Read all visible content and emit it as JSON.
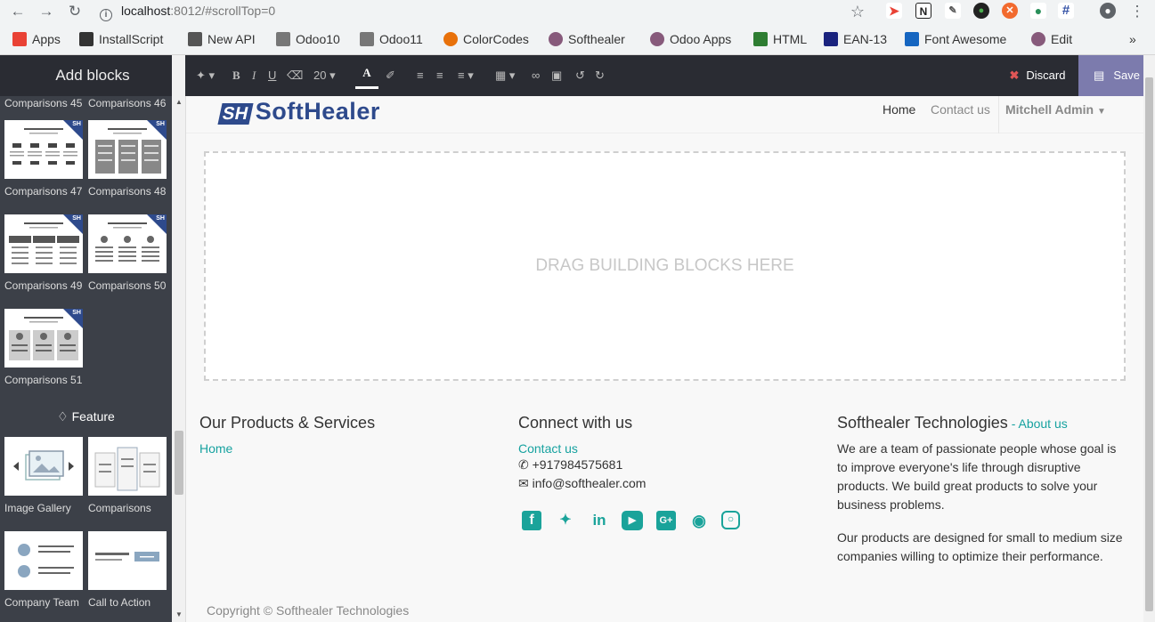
{
  "browser": {
    "url_host": "localhost",
    "url_rest": ":8012/#scrollTop=0",
    "bookmarks": [
      {
        "label": "Apps",
        "icon": "apps-grid-icon",
        "color": "#e94235"
      },
      {
        "label": "InstallScript",
        "icon": "github-icon",
        "color": "#333333"
      },
      {
        "label": "New API",
        "icon": "book-icon",
        "color": "#555555"
      },
      {
        "label": "Odoo10",
        "icon": "page-icon",
        "color": "#777777"
      },
      {
        "label": "Odoo11",
        "icon": "page-icon",
        "color": "#777777"
      },
      {
        "label": "ColorCodes",
        "icon": "colorwheel-icon",
        "color": "#e8710a"
      },
      {
        "label": "Softhealer",
        "icon": "odoo-circle-icon",
        "color": "#875a7b"
      },
      {
        "label": "Odoo Apps",
        "icon": "odoo-circle-icon",
        "color": "#875a7b"
      },
      {
        "label": "HTML",
        "icon": "html-icon",
        "color": "#2e7d32"
      },
      {
        "label": "EAN-13",
        "icon": "barcode-icon",
        "color": "#1a237e"
      },
      {
        "label": "Font Awesome",
        "icon": "flag-icon",
        "color": "#1565c0"
      },
      {
        "label": "Edit",
        "icon": "odoo-circle-icon",
        "color": "#875a7b"
      }
    ]
  },
  "sidebar": {
    "title": "Add blocks",
    "top_labels": [
      "Comparisons 45",
      "Comparisons 46"
    ],
    "blocks": [
      {
        "label": "Comparisons 47"
      },
      {
        "label": "Comparisons 48"
      },
      {
        "label": "Comparisons 49"
      },
      {
        "label": "Comparisons 50"
      },
      {
        "label": "Comparisons 51"
      }
    ],
    "sr_badge": "SH",
    "feature_section": "Feature",
    "feature_blocks": [
      {
        "label": "Image Gallery"
      },
      {
        "label": "Comparisons"
      },
      {
        "label": "Company Team"
      },
      {
        "label": "Call to Action"
      }
    ]
  },
  "toolbar": {
    "font_size": "20",
    "discard_label": "Discard",
    "save_label": "Save"
  },
  "site": {
    "logo_mark": "SH",
    "logo_text": "SoftHealer",
    "nav_home": "Home",
    "nav_contact": "Contact us",
    "user": "Mitchell Admin",
    "dropzone_text": "DRAG BUILDING BLOCKS HERE",
    "footer": {
      "col1_title": "Our Products & Services",
      "col1_link": "Home",
      "col2_title": "Connect with us",
      "col2_link": "Contact us",
      "phone": "+917984575681",
      "email": "info@softhealer.com",
      "col3_title": "Softhealer Technologies",
      "col3_sep": " - ",
      "col3_link": "About us",
      "para1": "We are a team of passionate people whose goal is to improve everyone's life through disruptive products. We build great products to solve your business problems.",
      "para2": "Our products are designed for small to medium size companies willing to optimize their performance.",
      "copyright": "Copyright © Softhealer Technologies"
    },
    "accent_color": "#17a2a0"
  }
}
